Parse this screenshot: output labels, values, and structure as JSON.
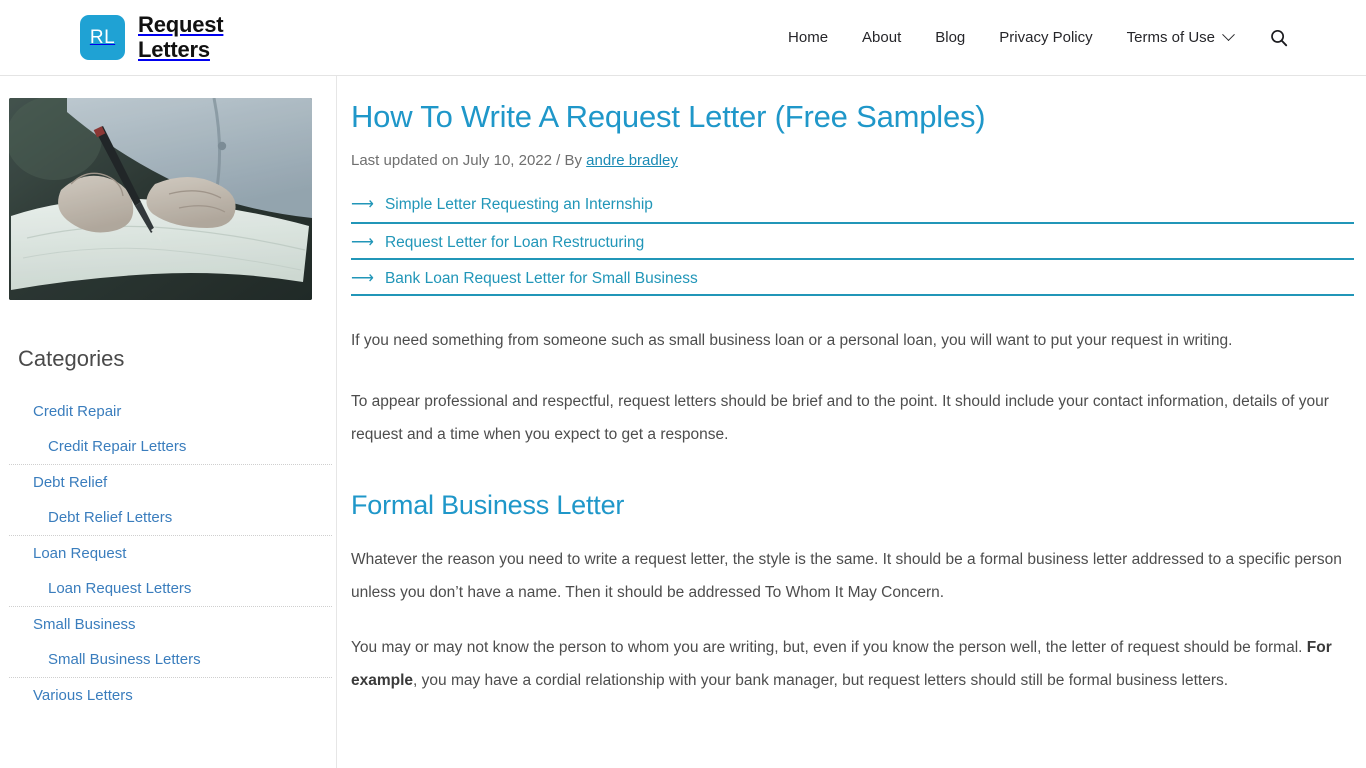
{
  "header": {
    "logo_initials": "RL",
    "brand_line1": "Request",
    "brand_line2": "Letters",
    "nav": [
      {
        "label": "Home",
        "has_chevron": false
      },
      {
        "label": "About",
        "has_chevron": false
      },
      {
        "label": "Blog",
        "has_chevron": false
      },
      {
        "label": "Privacy Policy",
        "has_chevron": false
      },
      {
        "label": "Terms of Use",
        "has_chevron": true
      }
    ],
    "search_icon": "search-icon"
  },
  "sidebar": {
    "thumbnail_alt": "Person signing a document with a pen on a dark desk",
    "categories_title": "Categories",
    "groups": [
      {
        "parent": "Credit Repair",
        "child": "Credit Repair Letters"
      },
      {
        "parent": "Debt Relief",
        "child": "Debt Relief Letters"
      },
      {
        "parent": "Loan Request",
        "child": "Loan Request Letters"
      },
      {
        "parent": "Small Business",
        "child": "Small Business Letters"
      },
      {
        "parent": "Various Letters",
        "child": ""
      }
    ]
  },
  "article": {
    "title": "How To Write A Request Letter (Free Samples)",
    "meta_prefix": "Last updated on July 10, 2022 / By",
    "author": "andre bradley",
    "related": [
      "Simple Letter Requesting an Internship",
      "Request Letter for Loan Restructuring",
      "Bank Loan Request Letter for Small Business"
    ],
    "paragraph_1": "If you need something from someone such as small business loan or a personal loan, you will want to put your request in writing.",
    "paragraph_2": "To appear professional and respectful, request letters should be brief and to the point. It should include your contact information, details of your request and a time when you expect to get a response.",
    "section_heading": "Formal Business Letter",
    "paragraph_3": "Whatever the reason you need to write a request letter, the style is the same. It should be a formal business letter addressed to a specific person unless you don’t have a name. Then it should be addressed To Whom It May Concern.",
    "paragraph_4_part1": "You may or may not know the person to whom you are writing, but, even if you know the person well, the letter of request should be formal. ",
    "paragraph_4_bold": "For example",
    "paragraph_4_part2": ", you may have a cordial relationship with your bank manager, but request letters should still be formal business letters."
  },
  "colors": {
    "brand_blue": "#1fa2d4",
    "heading_cyan": "#1f97c9",
    "link_teal": "#2196b8",
    "sidebar_link": "#3a7dbd",
    "body_text": "#4d4d4d"
  }
}
